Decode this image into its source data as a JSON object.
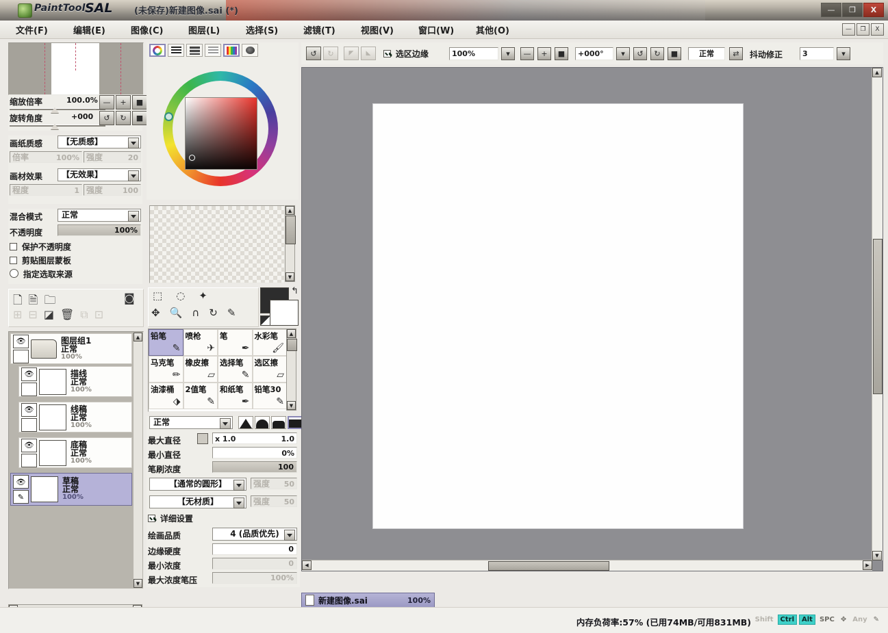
{
  "window": {
    "app_name_prefix": "PaintTool",
    "app_name": "SAL",
    "document_title": "(未保存)新建图像.sai (*)",
    "minimize": "—",
    "maximize": "❐",
    "close": "X",
    "mdi_minimize": "—",
    "mdi_restore": "❐",
    "mdi_close": "X"
  },
  "menu": {
    "items": [
      {
        "label": "文件(F)"
      },
      {
        "label": "编辑(E)"
      },
      {
        "label": "图像(C)"
      },
      {
        "label": "图层(L)"
      },
      {
        "label": "选择(S)"
      },
      {
        "label": "滤镜(T)"
      },
      {
        "label": "视图(V)"
      },
      {
        "label": "窗口(W)"
      },
      {
        "label": "其他(O)"
      }
    ]
  },
  "toolbar": {
    "undo": "↺",
    "redo": "↻",
    "undo2": "◤",
    "redo2": "◣",
    "selection_edge_label": "选区边缘",
    "selection_edge_checked": true,
    "zoom_value": "100%",
    "zoom_out": "—",
    "zoom_in": "+",
    "zoom_reset": "■",
    "rotate_value": "+000°",
    "rotate_ccw": "↺",
    "rotate_cw": "↻",
    "rotate_reset": "■",
    "view_mode": "正常",
    "flip_icon": "⇄",
    "stabilizer_label": "抖动修正",
    "stabilizer_value": "3"
  },
  "navigator": {
    "zoom_label": "缩放倍率",
    "zoom_value": "100.0%",
    "rotate_label": "旋转角度",
    "rotate_value": "+000",
    "btn_minus": "—",
    "btn_plus": "+",
    "btn_reset": "■",
    "btn_rot_ccw": "↺",
    "btn_rot_cw": "↻",
    "btn_rot_reset": "■"
  },
  "canvas_props": {
    "paper_texture_label": "画纸质感",
    "paper_texture_value": "【无质感】",
    "paper_scale_label": "倍率",
    "paper_scale_value": "100%",
    "paper_strength_label": "强度",
    "paper_strength_value": "20",
    "material_effect_label": "画材效果",
    "material_effect_value": "【无效果】",
    "material_level_label": "程度",
    "material_level_value": "1",
    "material_strength_label": "强度",
    "material_strength_value": "100"
  },
  "layer_props": {
    "blend_mode_label": "混合模式",
    "blend_mode_value": "正常",
    "opacity_label": "不透明度",
    "opacity_value": "100%",
    "opacity_percent": 100,
    "lock_alpha_label": "保护不透明度",
    "lock_alpha_checked": false,
    "clipping_label": "剪贴图层蒙板",
    "clipping_checked": false,
    "selection_source_label": "指定选取来源",
    "selection_source_checked": false
  },
  "layer_buttons": {
    "row1": [
      {
        "icon": "new-layer-icon",
        "glyph": "🗋",
        "enabled": true
      },
      {
        "icon": "new-linework-layer-icon",
        "glyph": "🗎",
        "enabled": true
      },
      {
        "icon": "new-folder-icon",
        "glyph": "🗀",
        "enabled": true
      },
      {
        "icon": "layer-mask-icon",
        "glyph": "◙",
        "enabled": true
      }
    ],
    "row2": [
      {
        "icon": "merge-down-icon",
        "glyph": "⊞",
        "enabled": false
      },
      {
        "icon": "merge-visible-icon",
        "glyph": "⊟",
        "enabled": false
      },
      {
        "icon": "clear-layer-icon",
        "glyph": "◪",
        "enabled": true
      },
      {
        "icon": "delete-layer-icon",
        "glyph": "🗑",
        "enabled": true
      },
      {
        "icon": "duplicate-layer-icon",
        "glyph": "⧉",
        "enabled": false
      },
      {
        "icon": "transfer-layer-icon",
        "glyph": "⊡",
        "enabled": false
      }
    ]
  },
  "layers": [
    {
      "name": "图层组1",
      "mode": "正常",
      "opacity": "100%",
      "type": "group",
      "visible": true,
      "selected": false
    },
    {
      "name": "描线",
      "mode": "正常",
      "opacity": "100%",
      "type": "layer",
      "visible": true,
      "selected": false
    },
    {
      "name": "线稿",
      "mode": "正常",
      "opacity": "100%",
      "type": "layer",
      "visible": true,
      "selected": false
    },
    {
      "name": "底稿",
      "mode": "正常",
      "opacity": "100%",
      "type": "layer",
      "visible": true,
      "selected": false
    },
    {
      "name": "草稿",
      "mode": "正常",
      "opacity": "100%",
      "type": "layer",
      "visible": true,
      "selected": true
    }
  ],
  "color_panel": {
    "tabs": [
      {
        "name": "color-wheel-tab",
        "selected": true
      },
      {
        "name": "rgb-slider-tab",
        "selected": false
      },
      {
        "name": "hsv-slider-tab",
        "selected": false
      },
      {
        "name": "gradient-tab",
        "selected": false
      },
      {
        "name": "palette-tab",
        "selected": true
      },
      {
        "name": "scratchpad-tab",
        "selected": false
      }
    ],
    "foreground_color": "#2d2d2d",
    "background_color": "#ffffff",
    "swap_icon": "↰"
  },
  "select_tools": [
    {
      "name": "rect-select-tool",
      "glyph": "⬚"
    },
    {
      "name": "lasso-select-tool",
      "glyph": "◌"
    },
    {
      "name": "magic-wand-tool",
      "glyph": "✦"
    },
    {
      "name": "move-tool",
      "glyph": "✥"
    },
    {
      "name": "zoom-tool",
      "glyph": "🔍"
    },
    {
      "name": "rotate-view-tool",
      "glyph": "∩"
    },
    {
      "name": "hand-tool",
      "glyph": "↻"
    },
    {
      "name": "eyedropper-tool",
      "glyph": "✎"
    }
  ],
  "brushes": [
    {
      "label": "铅笔",
      "icon": "pencil-icon",
      "selected": true
    },
    {
      "label": "喷枪",
      "icon": "airbrush-icon",
      "selected": false
    },
    {
      "label": "笔",
      "icon": "pen-icon",
      "selected": false
    },
    {
      "label": "水彩笔",
      "icon": "watercolor-icon",
      "selected": false
    },
    {
      "label": "马克笔",
      "icon": "marker-icon",
      "selected": false
    },
    {
      "label": "橡皮擦",
      "icon": "eraser-icon",
      "selected": false
    },
    {
      "label": "选择笔",
      "icon": "select-pen-icon",
      "selected": false
    },
    {
      "label": "选区擦",
      "icon": "select-eraser-icon",
      "selected": false
    },
    {
      "label": "油漆桶",
      "icon": "bucket-icon",
      "selected": false
    },
    {
      "label": "2值笔",
      "icon": "binary-pen-icon",
      "selected": false
    },
    {
      "label": "和纸笔",
      "icon": "washi-pen-icon",
      "selected": false
    },
    {
      "label": "铅笔30",
      "icon": "pencil30-icon",
      "selected": false
    }
  ],
  "brush_settings": {
    "blend_mode": "正常",
    "max_diameter_label": "最大直径",
    "max_diameter_unit": "x 1.0",
    "max_diameter_value": "1.0",
    "min_diameter_label": "最小直径",
    "min_diameter_value": "0%",
    "density_label": "笔刷浓度",
    "density_value": "100",
    "density_percent": 100,
    "shape_value": "【通常的圆形】",
    "shape_strength_label": "强度",
    "shape_strength_value": "50",
    "texture_value": "【无材质】",
    "texture_strength_label": "强度",
    "texture_strength_value": "50",
    "detail_label": "详细设置",
    "detail_checked": true,
    "quality_label": "绘画品质",
    "quality_value": "4 (品质优先)",
    "edge_hardness_label": "边缘硬度",
    "edge_hardness_value": "0",
    "min_density_label": "最小浓度",
    "min_density_value": "0",
    "max_density_pressure_label": "最大浓度笔压",
    "max_density_pressure_value": "100%"
  },
  "document_tab": {
    "name": "新建图像.sai",
    "zoom": "100%"
  },
  "statusbar": {
    "memory_text": "内存负荷率:57% (已用74MB/可用831MB)",
    "keys": [
      {
        "label": "Shift",
        "state": "ghost"
      },
      {
        "label": "Ctrl",
        "state": "on"
      },
      {
        "label": "Alt",
        "state": "on"
      },
      {
        "label": "SPC",
        "state": "off"
      },
      {
        "label": "✥",
        "state": "off"
      },
      {
        "label": "Any",
        "state": "ghost"
      },
      {
        "label": "✎",
        "state": "off"
      }
    ]
  }
}
